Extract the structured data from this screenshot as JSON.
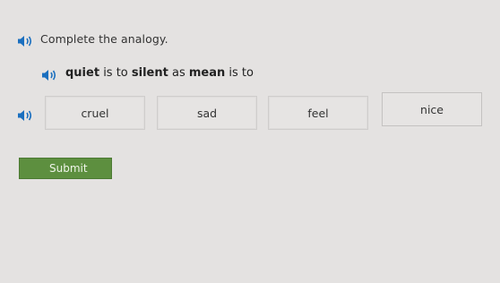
{
  "question": {
    "prompt": "Complete the analogy.",
    "analogy": {
      "word1": "quiet",
      "connector1": " is to ",
      "word2": "silent",
      "connector2": " as ",
      "word3": "mean",
      "connector3": " is to"
    }
  },
  "choices": [
    {
      "label": "cruel"
    },
    {
      "label": "sad"
    },
    {
      "label": "feel"
    },
    {
      "label": "nice"
    }
  ],
  "submit": {
    "label": "Submit"
  },
  "colors": {
    "speaker": "#1a6fbf",
    "submit_bg": "#5d8f3f",
    "background": "#e4e2e1"
  },
  "icons": [
    "speaker-icon"
  ]
}
